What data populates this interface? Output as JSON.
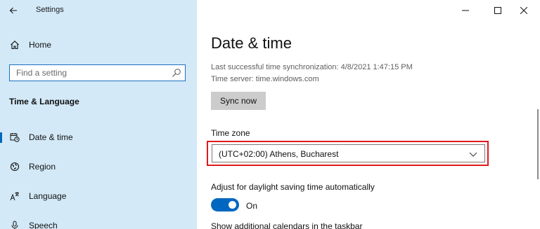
{
  "app": {
    "title": "Settings"
  },
  "sidebar": {
    "home_label": "Home",
    "search_placeholder": "Find a setting",
    "section_header": "Time & Language",
    "items": [
      {
        "label": "Date & time",
        "icon": "calendar-clock-icon",
        "selected": true
      },
      {
        "label": "Region",
        "icon": "globe-icon",
        "selected": false
      },
      {
        "label": "Language",
        "icon": "language-icon",
        "selected": false
      },
      {
        "label": "Speech",
        "icon": "microphone-icon",
        "selected": false
      }
    ]
  },
  "main": {
    "title": "Date & time",
    "sync_status": "Last successful time synchronization: 4/8/2021 1:47:15 PM",
    "time_server": "Time server: time.windows.com",
    "sync_button": "Sync now",
    "timezone": {
      "label": "Time zone",
      "selected": "(UTC+02:00) Athens, Bucharest"
    },
    "daylight": {
      "label": "Adjust for daylight saving time automatically",
      "state": "On",
      "enabled": true
    },
    "calendars_label": "Show additional calendars in the taskbar"
  },
  "colors": {
    "sidebar_bg": "#d3e9f7",
    "accent": "#0067c0",
    "highlight_border": "#e0191c",
    "button_bg": "#cccccc"
  }
}
